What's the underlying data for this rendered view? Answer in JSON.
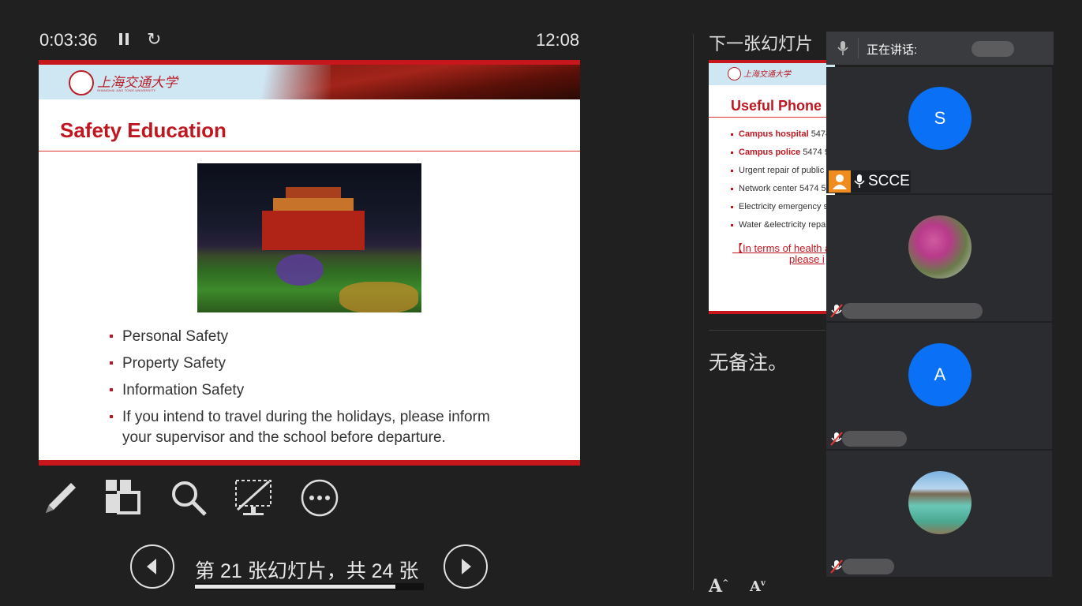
{
  "presenter": {
    "elapsed_time": "0:03:36",
    "clock": "12:08",
    "pause_icon": "pause-icon",
    "restart_icon": "restart-icon"
  },
  "current_slide": {
    "logo_text": "上海交通大学",
    "logo_subtext": "SHANGHAI JIAO TONG UNIVERSITY",
    "title": "Safety Education",
    "bullets": [
      "Personal Safety",
      "Property Safety",
      "Information Safety",
      "If you intend to travel during the holidays, please inform your supervisor and the school before departure."
    ]
  },
  "tools": [
    "pen-icon",
    "slides-grid-icon",
    "zoom-icon",
    "black-screen-icon",
    "more-options-icon"
  ],
  "navigation": {
    "counter": "第 21 张幻灯片，共 24 张",
    "current": 21,
    "total": 24,
    "prev_icon": "chevron-left-icon",
    "next_icon": "chevron-right-icon"
  },
  "next_slide": {
    "label": "下一张幻灯片",
    "logo_text": "上海交通大学",
    "title": "Useful Phone",
    "items": [
      {
        "label": "Campus hospital",
        "value": "5474"
      },
      {
        "label": "Campus police",
        "value": "5474 9"
      },
      {
        "label": "",
        "value": "Urgent repair of public"
      },
      {
        "label": "",
        "value": "Network center 5474 5"
      },
      {
        "label": "",
        "value": "Electricity emergency s"
      },
      {
        "label": "",
        "value": "Water &electricity repa"
      }
    ],
    "link_line1": "【In terms of health a",
    "link_line2": "please i"
  },
  "notes": {
    "text": "无备注。",
    "font_increase_label": "A",
    "font_decrease_label": "A"
  },
  "meeting": {
    "speaking_label": "正在讲话:",
    "participants": [
      {
        "type": "letter",
        "initial": "S",
        "name": "SCCE",
        "role_badge": "host-icon",
        "mic": "on"
      },
      {
        "type": "photo",
        "name": "",
        "mic": "muted"
      },
      {
        "type": "letter",
        "initial": "A",
        "name": "",
        "mic": "muted"
      },
      {
        "type": "photo",
        "name": "",
        "mic": "muted"
      }
    ]
  },
  "colors": {
    "background": "#202020",
    "slide_red": "#c0161f",
    "avatar_blue": "#0a70f5",
    "host_orange": "#f08c1e"
  }
}
